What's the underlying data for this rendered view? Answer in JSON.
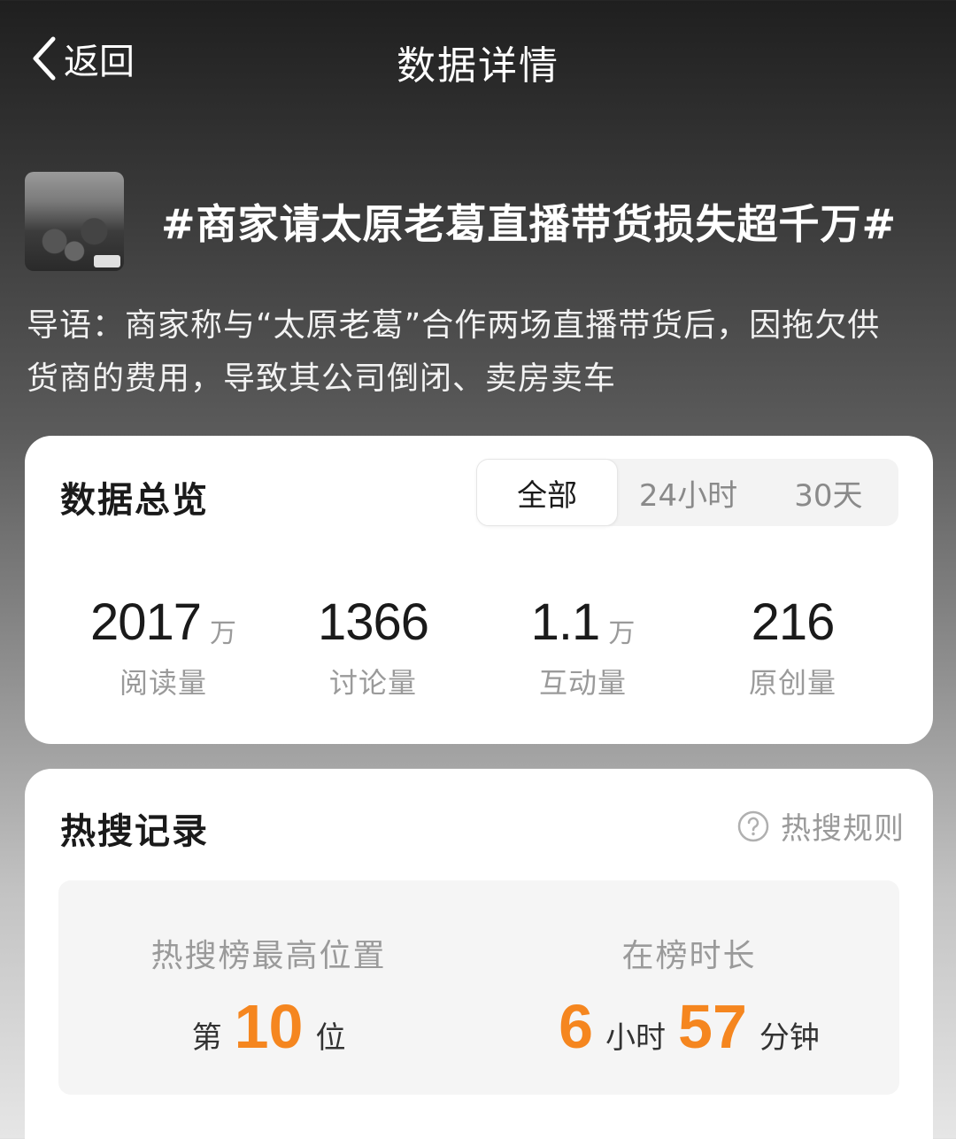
{
  "nav": {
    "back_label": "返回",
    "title": "数据详情"
  },
  "topic": {
    "title": "#商家请太原老葛直播带货损失超千万#",
    "intro_line1": "导语：商家称与“太原老葛”合作两场直播带货后，因拖欠供",
    "intro_line2": "货商的费用，导致其公司倒闭、卖房卖车"
  },
  "overview": {
    "title": "数据总览",
    "tabs": [
      "全部",
      "24小时",
      "30天"
    ],
    "active_tab": "全部",
    "stats": [
      {
        "value": "2017",
        "unit": "万",
        "label": "阅读量"
      },
      {
        "value": "1366",
        "unit": "",
        "label": "讨论量"
      },
      {
        "value": "1.1",
        "unit": "万",
        "label": "互动量"
      },
      {
        "value": "216",
        "unit": "",
        "label": "原创量"
      }
    ]
  },
  "hot": {
    "title": "热搜记录",
    "rules_label": "热搜规则",
    "highest": {
      "label": "热搜榜最高位置",
      "prefix": "第",
      "value": "10",
      "suffix": "位"
    },
    "duration": {
      "label": "在榜时长",
      "hours": "6",
      "hours_unit": "小时",
      "minutes": "57",
      "minutes_unit": "分钟"
    }
  },
  "colors": {
    "accent": "#f5861f",
    "card_bg": "#ffffff",
    "muted_text": "#9a9a9a"
  },
  "icons": {
    "back": "chevron-left-icon",
    "rules": "question-circle-icon"
  }
}
